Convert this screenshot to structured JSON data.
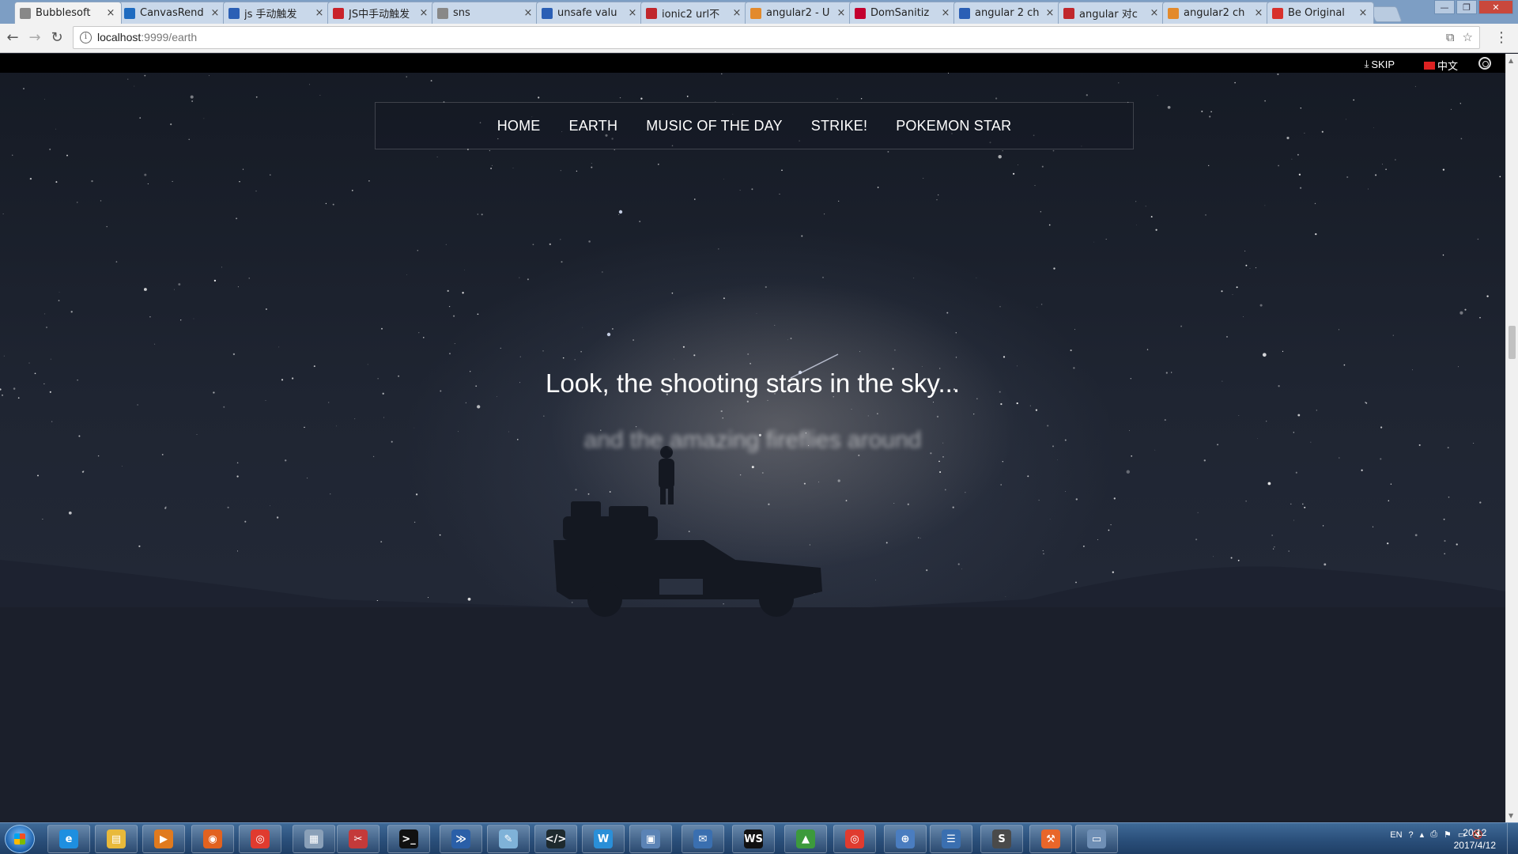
{
  "browser": {
    "tabs": [
      {
        "title": "Bubblesoft",
        "favicon_color": "#888888",
        "favicon": "page-icon"
      },
      {
        "title": "CanvasRend",
        "favicon_color": "#1e6bc0",
        "favicon": "blue-logo-icon"
      },
      {
        "title": "js 手动触发",
        "favicon_color": "#2b5fb5",
        "favicon": "paw-icon"
      },
      {
        "title": "JS中手动触发",
        "favicon_color": "#c9222a",
        "favicon": "colorful-logo-icon"
      },
      {
        "title": "sns",
        "favicon_color": "#888888",
        "favicon": "page-icon"
      },
      {
        "title": "unsafe valu",
        "favicon_color": "#2b5fb5",
        "favicon": "paw-icon"
      },
      {
        "title": "ionic2 url不",
        "favicon_color": "#c0272d",
        "favicon": "c-logo-icon"
      },
      {
        "title": "angular2 - U",
        "favicon_color": "#e38a2c",
        "favicon": "stack-icon"
      },
      {
        "title": "DomSanitiz",
        "favicon_color": "#c3002f",
        "favicon": "angular-icon"
      },
      {
        "title": "angular 2 ch",
        "favicon_color": "#2b5fb5",
        "favicon": "paw-icon"
      },
      {
        "title": "angular 对c",
        "favicon_color": "#c0272d",
        "favicon": "c-logo-icon"
      },
      {
        "title": "angular2 ch",
        "favicon_color": "#e38a2c",
        "favicon": "stack-icon"
      },
      {
        "title": "Be Original",
        "favicon_color": "#d8312c",
        "favicon": "s-logo-icon"
      }
    ],
    "url_host": "localhost",
    "url_path": ":9999/earth"
  },
  "page": {
    "topbar": {
      "skip_label": "SKIP",
      "lang_label": "中文"
    },
    "nav": [
      "HOME",
      "EARTH",
      "MUSIC OF THE DAY",
      "STRIKE!",
      "POKEMON STAR"
    ],
    "headline": "Look, the shooting stars in the sky...",
    "subline": "and the amazing fireflies around"
  },
  "taskbar": {
    "apps": [
      {
        "name": "ie",
        "color": "#1e8fe0",
        "glyph": "e"
      },
      {
        "name": "explorer",
        "color": "#e8b93a",
        "glyph": "▤"
      },
      {
        "name": "media-player",
        "color": "#e07a1e",
        "glyph": "▶"
      },
      {
        "name": "firefox",
        "color": "#e2621f",
        "glyph": "◉"
      },
      {
        "name": "chrome",
        "color": "#e03b2f",
        "glyph": "◎"
      },
      {
        "name": "calculator",
        "color": "#8aa0b8",
        "glyph": "▦"
      },
      {
        "name": "snipping-tool",
        "color": "#c43a3a",
        "glyph": "✂"
      },
      {
        "name": "cmd",
        "color": "#111111",
        "glyph": ">_"
      },
      {
        "name": "powershell",
        "color": "#2a5fa8",
        "glyph": "≫"
      },
      {
        "name": "notepad",
        "color": "#7fb2d8",
        "glyph": "✎"
      },
      {
        "name": "terminal",
        "color": "#1e2a2e",
        "glyph": "</>"
      },
      {
        "name": "word-app",
        "color": "#2a8fd8",
        "glyph": "W"
      },
      {
        "name": "remote-desktop",
        "color": "#5b83b5",
        "glyph": "▣"
      },
      {
        "name": "outlook",
        "color": "#3a6fb0",
        "glyph": "✉"
      },
      {
        "name": "webstorm",
        "color": "#111111",
        "glyph": "WS"
      },
      {
        "name": "chart-app",
        "color": "#3c9a3c",
        "glyph": "▲"
      },
      {
        "name": "chrome-2",
        "color": "#e03b2f",
        "glyph": "◎"
      },
      {
        "name": "network",
        "color": "#4a7dc0",
        "glyph": "⊕"
      },
      {
        "name": "messenger",
        "color": "#3a6fb0",
        "glyph": "☰"
      },
      {
        "name": "sublime",
        "color": "#4a4a4a",
        "glyph": "S"
      },
      {
        "name": "tool-orange",
        "color": "#e8662a",
        "glyph": "⚒"
      },
      {
        "name": "monitor",
        "color": "#6f8fb5",
        "glyph": "▭"
      }
    ],
    "tray": {
      "lang": "EN",
      "time": "20:12",
      "date": "2017/4/12"
    }
  }
}
